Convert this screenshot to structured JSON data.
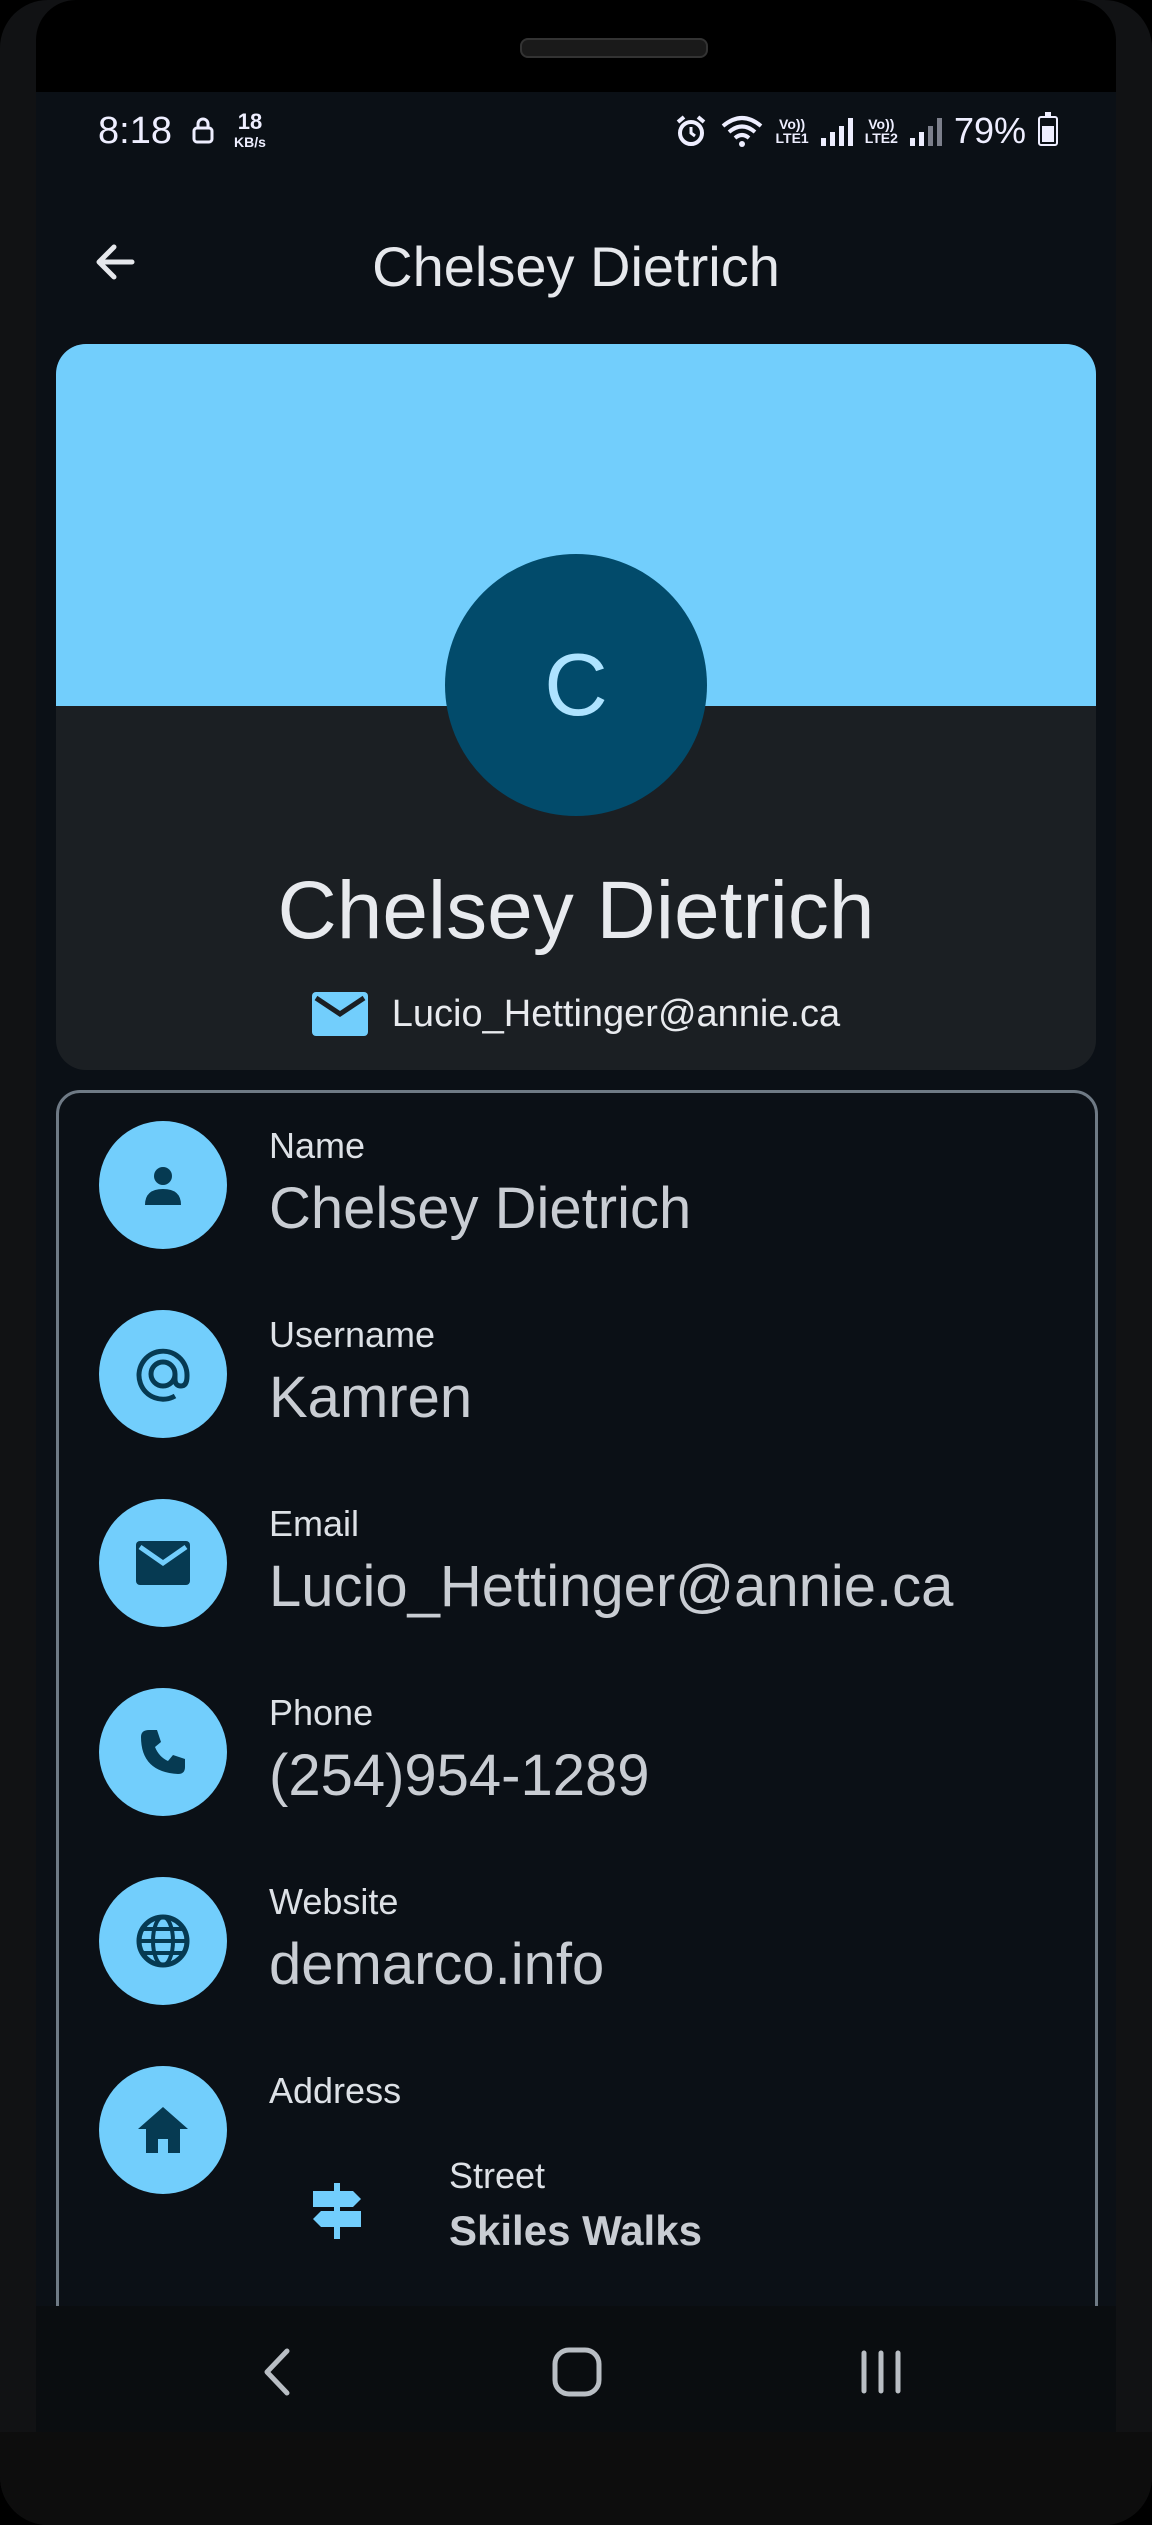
{
  "status_bar": {
    "time": "8:18",
    "speed_value": "18",
    "speed_unit": "KB/s",
    "lte1": "LTE1",
    "lte2": "LTE2",
    "volte": "Vo))",
    "battery": "79%"
  },
  "app_bar": {
    "title": "Chelsey Dietrich",
    "back_icon": "arrow-back-icon"
  },
  "profile_card": {
    "avatar_letter": "C",
    "name": "Chelsey Dietrich",
    "email": "Lucio_Hettinger@annie.ca",
    "banner_color": "#72cefc",
    "avatar_color": "#024b6b"
  },
  "details": [
    {
      "icon": "person-icon",
      "label": "Name",
      "value": "Chelsey Dietrich"
    },
    {
      "icon": "at-sign-icon",
      "label": "Username",
      "value": "Kamren"
    },
    {
      "icon": "mail-icon",
      "label": "Email",
      "value": "Lucio_Hettinger@annie.ca"
    },
    {
      "icon": "phone-icon",
      "label": "Phone",
      "value": "(254)954-1289"
    },
    {
      "icon": "globe-icon",
      "label": "Website",
      "value": "demarco.info"
    },
    {
      "icon": "home-icon",
      "label": "Address",
      "value": ""
    }
  ],
  "address": {
    "street_label": "Street",
    "street_value": "Skiles Walks",
    "street_icon": "signpost-icon"
  },
  "nav_bar": {
    "back": "nav-back-icon",
    "home": "nav-home-icon",
    "recents": "nav-recents-icon"
  }
}
